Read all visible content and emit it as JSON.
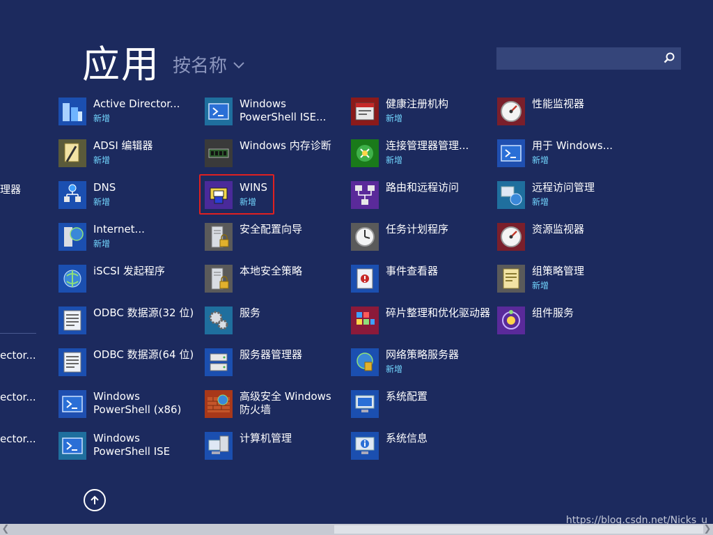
{
  "header": {
    "title": "应用",
    "sort_label": "按名称"
  },
  "search": {
    "placeholder": ""
  },
  "left_fragments": [
    "理器",
    "ector...",
    "ector...",
    "ector..."
  ],
  "apps": [
    {
      "name": "Active Director...",
      "badge": "新增",
      "icon": "active-directory-icon"
    },
    {
      "name": "Windows PowerShell ISE...",
      "badge": "",
      "icon": "powershell-ise-icon"
    },
    {
      "name": "健康注册机构",
      "badge": "新增",
      "icon": "health-registration-icon"
    },
    {
      "name": "性能监视器",
      "badge": "",
      "icon": "performance-monitor-icon"
    },
    {
      "name": "ADSI 编辑器",
      "badge": "新增",
      "icon": "adsi-edit-icon"
    },
    {
      "name": "Windows 内存诊断",
      "badge": "",
      "icon": "memory-diagnostic-icon"
    },
    {
      "name": "连接管理器管理...",
      "badge": "新增",
      "icon": "connection-manager-icon"
    },
    {
      "name": "用于 Windows...",
      "badge": "新增",
      "icon": "powershell-icon"
    },
    {
      "name": "DNS",
      "badge": "新增",
      "icon": "dns-icon"
    },
    {
      "name": "WINS",
      "badge": "新增",
      "icon": "wins-icon"
    },
    {
      "name": "路由和远程访问",
      "badge": "",
      "icon": "routing-remote-access-icon"
    },
    {
      "name": "远程访问管理",
      "badge": "新增",
      "icon": "remote-access-management-icon"
    },
    {
      "name": "Internet...",
      "badge": "新增",
      "icon": "internet-information-services-icon"
    },
    {
      "name": "安全配置向导",
      "badge": "",
      "icon": "security-config-wizard-icon"
    },
    {
      "name": "任务计划程序",
      "badge": "",
      "icon": "task-scheduler-icon"
    },
    {
      "name": "资源监视器",
      "badge": "",
      "icon": "resource-monitor-icon"
    },
    {
      "name": "iSCSI 发起程序",
      "badge": "",
      "icon": "iscsi-initiator-icon"
    },
    {
      "name": "本地安全策略",
      "badge": "",
      "icon": "local-security-policy-icon"
    },
    {
      "name": "事件查看器",
      "badge": "",
      "icon": "event-viewer-icon"
    },
    {
      "name": "组策略管理",
      "badge": "新增",
      "icon": "group-policy-icon"
    },
    {
      "name": "ODBC 数据源(32 位)",
      "badge": "",
      "icon": "odbc-32-icon"
    },
    {
      "name": "服务",
      "badge": "",
      "icon": "services-icon"
    },
    {
      "name": "碎片整理和优化驱动器",
      "badge": "",
      "icon": "defrag-icon"
    },
    {
      "name": "组件服务",
      "badge": "",
      "icon": "component-services-icon"
    },
    {
      "name": "ODBC 数据源(64 位)",
      "badge": "",
      "icon": "odbc-64-icon"
    },
    {
      "name": "服务器管理器",
      "badge": "",
      "icon": "server-manager-icon"
    },
    {
      "name": "网络策略服务器",
      "badge": "新增",
      "icon": "network-policy-server-icon"
    },
    null,
    {
      "name": "Windows PowerShell (x86)",
      "badge": "",
      "icon": "powershell-x86-icon"
    },
    {
      "name": "高级安全 Windows 防火墙",
      "badge": "",
      "icon": "firewall-icon"
    },
    {
      "name": "系统配置",
      "badge": "",
      "icon": "system-config-icon"
    },
    null,
    {
      "name": "Windows PowerShell ISE",
      "badge": "",
      "icon": "powershell-ise-icon"
    },
    {
      "name": "计算机管理",
      "badge": "",
      "icon": "computer-management-icon"
    },
    {
      "name": "系统信息",
      "badge": "",
      "icon": "system-information-icon"
    },
    null
  ],
  "watermark": "https://blog.csdn.net/Nicks_u",
  "colors": {
    "background": "#1c2a5e",
    "badge": "#73d7ff",
    "highlight": "#e02020"
  }
}
